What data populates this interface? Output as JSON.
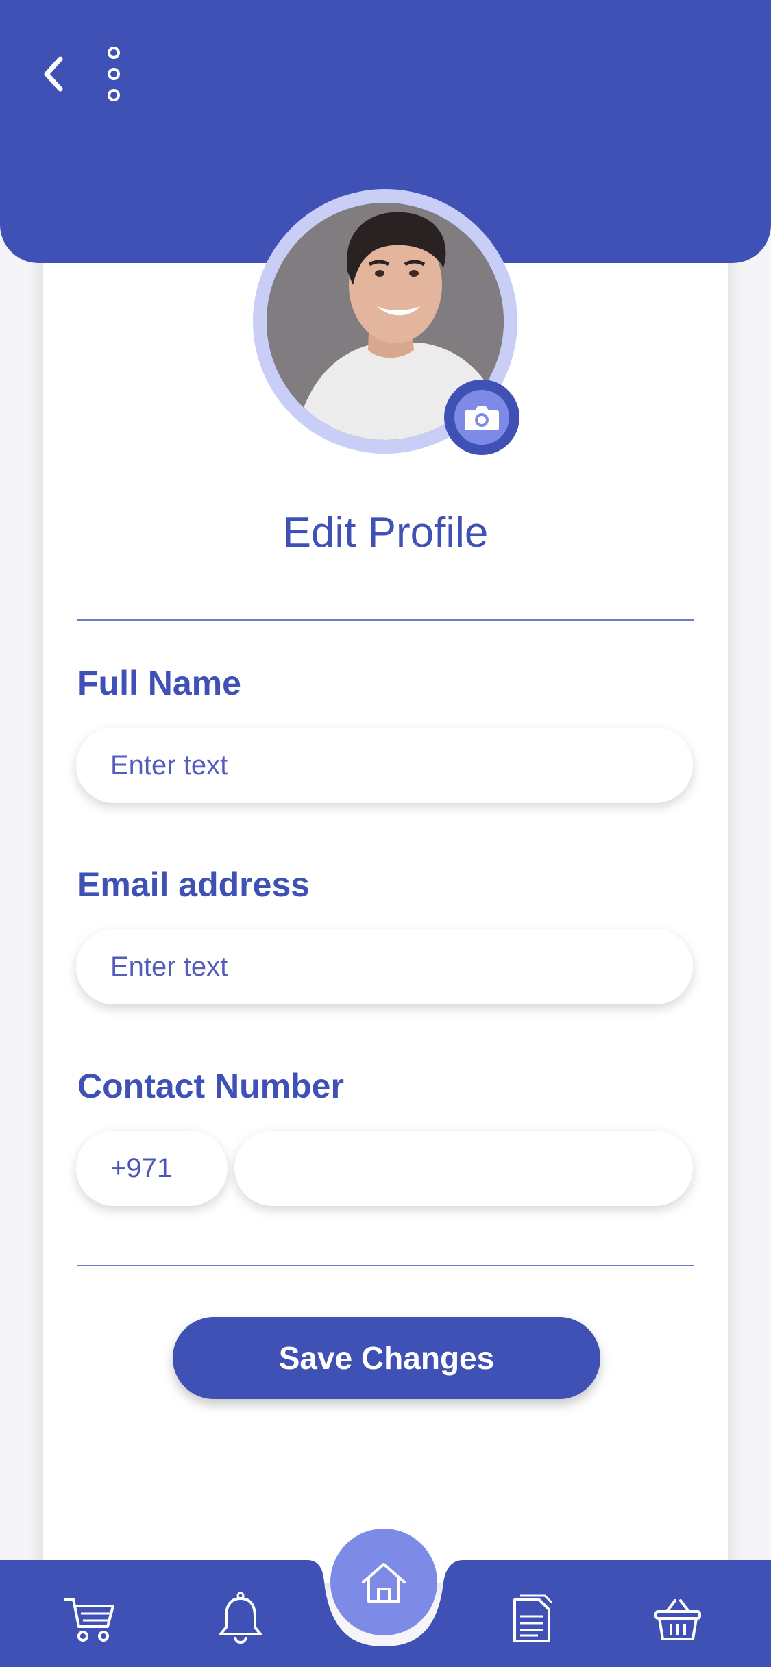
{
  "header": {
    "back_icon": "chevron-left-icon",
    "menu_icon": "more-vertical-icon",
    "color": "#3f51b5"
  },
  "profile": {
    "camera_icon": "camera-icon"
  },
  "page_title": "Edit Profile",
  "form": {
    "full_name": {
      "label": "Full Name",
      "placeholder": "Enter text",
      "value": ""
    },
    "email": {
      "label": "Email address",
      "placeholder": "Enter text",
      "value": ""
    },
    "contact": {
      "label": "Contact Number",
      "country_code": "+971",
      "value": ""
    }
  },
  "save_label": "Save Changes",
  "bottom_nav": {
    "items": [
      "cart-icon",
      "bell-icon",
      "home-icon",
      "documents-icon",
      "basket-icon"
    ],
    "active": "home-icon",
    "accent": "#7e8be6"
  }
}
